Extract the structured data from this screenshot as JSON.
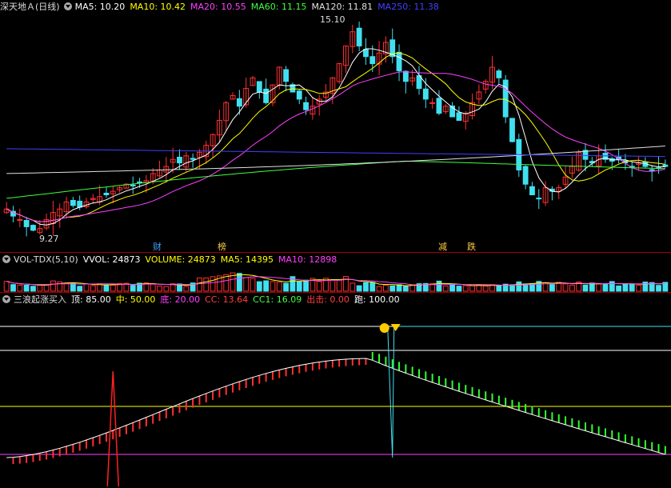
{
  "main": {
    "title": "深天地Ａ(日线)",
    "ma": [
      {
        "label": "MA5: 10.20",
        "color": "#ffffff"
      },
      {
        "label": "MA10: 10.42",
        "color": "#ffff00"
      },
      {
        "label": "MA20: 10.55",
        "color": "#ff40ff"
      },
      {
        "label": "MA60: 11.15",
        "color": "#40ff40"
      },
      {
        "label": "MA120: 11.81",
        "color": "#e0e0e0"
      },
      {
        "label": "MA250: 11.38",
        "color": "#4040ff"
      }
    ],
    "high_label": "15.10",
    "low_label": "9.27",
    "events": [
      {
        "text": "财",
        "color": "#40a0ff"
      },
      {
        "text": "榜",
        "color": "#ffcc44"
      },
      {
        "text": "减",
        "color": "#ffcc44"
      },
      {
        "text": "跌",
        "color": "#ffcc44"
      }
    ]
  },
  "vol": {
    "title": "VOL-TDX(5,10)",
    "items": [
      {
        "label": "VVOL: 24873",
        "color": "#ffffff"
      },
      {
        "label": "VOLUME: 24873",
        "color": "#ffff00"
      },
      {
        "label": "MA5: 14395",
        "color": "#ffff00"
      },
      {
        "label": "MA10: 12898",
        "color": "#ff40ff"
      }
    ]
  },
  "ind": {
    "title": "三浪起涨买入",
    "items": [
      {
        "label": "顶: 85.00",
        "color": "#ffffff"
      },
      {
        "label": "中: 50.00",
        "color": "#ffff00"
      },
      {
        "label": "底: 20.00",
        "color": "#ff40ff"
      },
      {
        "label": "CC: 13.64",
        "color": "#ff4040"
      },
      {
        "label": "CC1: 16.09",
        "color": "#40ff40"
      },
      {
        "label": "出击: 0.00",
        "color": "#ff4040"
      },
      {
        "label": "跑: 100.00",
        "color": "#ffffff"
      }
    ]
  },
  "colors": {
    "up": "#ff3030",
    "down": "#40e0f0",
    "ma5": "#ffffff",
    "ma10": "#ffff00",
    "ma20": "#ff40ff",
    "ma60": "#40ff40",
    "ma120": "#e0e0e0",
    "ma250": "#4040ff"
  },
  "chart_data": {
    "type": "candlestick",
    "closes": [
      9.9,
      9.7,
      9.6,
      9.4,
      9.3,
      9.35,
      9.6,
      9.8,
      9.9,
      10.1,
      10.0,
      9.95,
      10.1,
      10.2,
      10.25,
      10.3,
      10.4,
      10.5,
      10.6,
      10.55,
      10.65,
      10.7,
      10.9,
      11.0,
      11.1,
      11.3,
      11.2,
      11.4,
      11.3,
      11.5,
      11.7,
      12.0,
      12.4,
      12.9,
      13.1,
      12.8,
      13.3,
      13.6,
      13.2,
      12.9,
      13.4,
      13.9,
      13.5,
      13.2,
      13.0,
      12.7,
      12.8,
      13.0,
      13.2,
      13.6,
      14.0,
      14.5,
      14.9,
      14.5,
      14.2,
      14.0,
      14.3,
      14.6,
      14.2,
      13.8,
      13.5,
      13.6,
      13.3,
      13.0,
      12.9,
      12.6,
      12.8,
      12.5,
      12.4,
      12.6,
      12.9,
      13.2,
      13.5,
      13.9,
      13.6,
      12.5,
      11.8,
      11.0,
      10.6,
      10.3,
      10.2,
      10.5,
      10.4,
      10.5,
      10.8,
      11.1,
      11.5,
      11.3,
      11.2,
      11.4,
      11.3,
      11.25,
      11.3,
      11.2,
      11.1,
      11.2,
      11.1,
      11.0,
      11.05,
      11.1
    ],
    "ma_values": {
      "MA5": 10.2,
      "MA10": 10.42,
      "MA20": 10.55,
      "MA60": 11.15,
      "MA120": 11.81,
      "MA250": 11.38
    },
    "high": 15.1,
    "low": 9.27
  }
}
